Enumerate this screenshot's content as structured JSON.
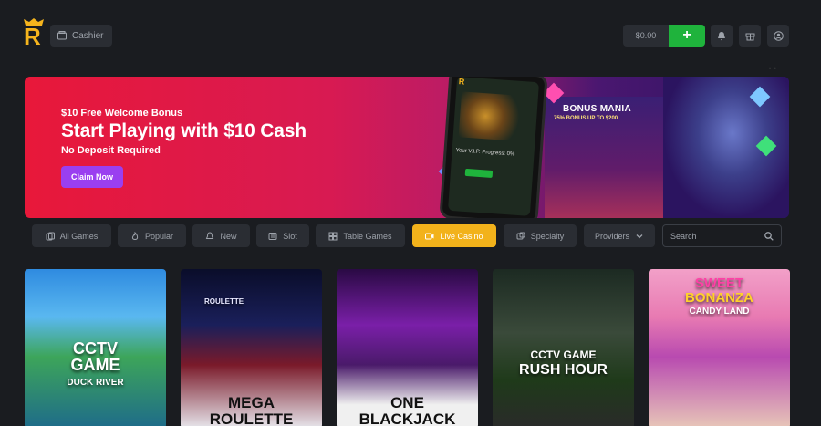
{
  "header": {
    "logo_letter": "R",
    "cashier_label": "Cashier",
    "balance": "$0.00",
    "deposit_symbol": "+"
  },
  "banner": {
    "kicker": "$10 Free Welcome Bonus",
    "headline": "Start Playing with $10 Cash",
    "sub": "No Deposit Required",
    "cta": "Claim Now",
    "promo_title": "BONUS MANIA",
    "promo_sub": "75% BONUS UP TO $200",
    "phone_text": "Your V.I.P. Progress: 0%"
  },
  "filters": [
    {
      "label": "All Games",
      "icon": "cards-icon"
    },
    {
      "label": "Popular",
      "icon": "flame-icon"
    },
    {
      "label": "New",
      "icon": "bell-icon"
    },
    {
      "label": "Slot",
      "icon": "slot-icon"
    },
    {
      "label": "Table Games",
      "icon": "table-icon"
    },
    {
      "label": "Live Casino",
      "icon": "live-icon",
      "active": true
    },
    {
      "label": "Specialty",
      "icon": "dice-icon"
    },
    {
      "label": "Providers",
      "icon": "chevron-down-icon"
    }
  ],
  "search": {
    "placeholder": "Search"
  },
  "games": [
    {
      "title_line1": "CCTV",
      "title_line2": "GAME",
      "title_line3": "DUCK RIVER"
    },
    {
      "badge": "ROULETTE",
      "title_line1": "MEGA",
      "title_line2": "ROULETTE"
    },
    {
      "title_line1": "ONE",
      "title_line2": "BLACKJACK"
    },
    {
      "title_line1": "CCTV GAME",
      "title_line2": "RUSH HOUR"
    },
    {
      "title_line1": "SWEET",
      "title_line2": "BONANZA",
      "title_line3": "CANDY LAND"
    }
  ],
  "colors": {
    "accent_gold": "#f2b21b",
    "deposit_green": "#1fb33c",
    "claim_purple": "#9a3ff0",
    "banner_red": "#e8183a"
  }
}
